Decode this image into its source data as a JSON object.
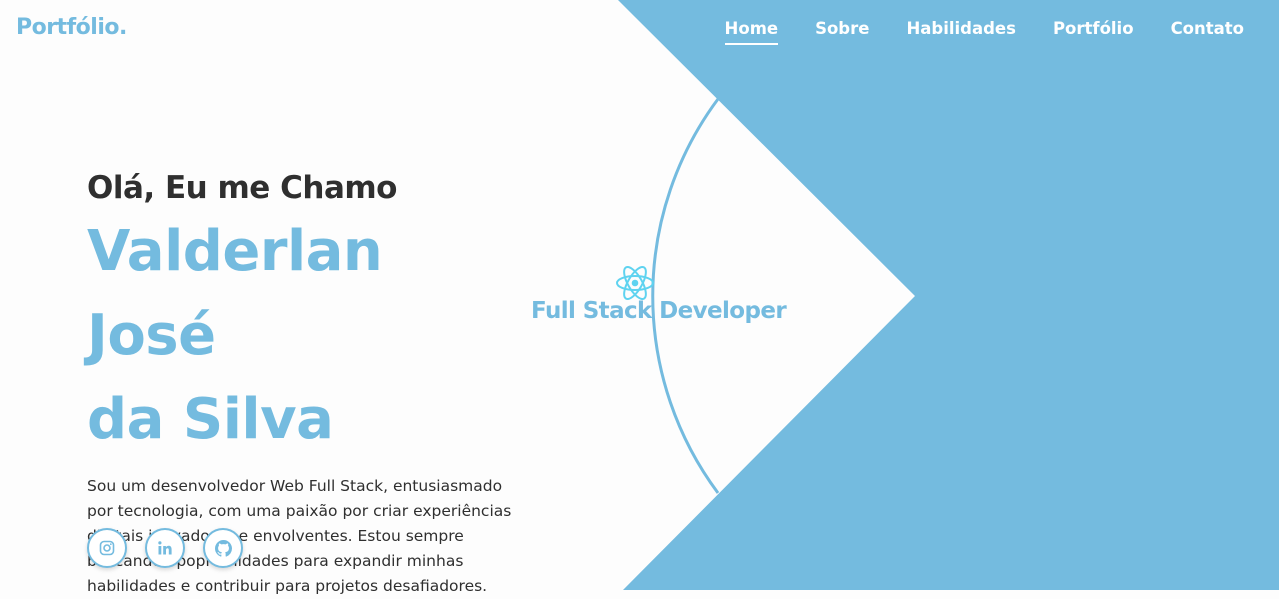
{
  "colors": {
    "accent": "#74bbdf",
    "text": "#2f2f2f",
    "background": "#fdfdfd"
  },
  "header": {
    "logo": "Portfólio.",
    "nav": [
      {
        "label": "Home",
        "active": true
      },
      {
        "label": "Sobre",
        "active": false
      },
      {
        "label": "Habilidades",
        "active": false
      },
      {
        "label": "Portfólio",
        "active": false
      },
      {
        "label": "Contato",
        "active": false
      }
    ]
  },
  "hero": {
    "greeting": "Olá, Eu me Chamo",
    "name_line1": "Valderlan José",
    "name_line2": "da Silva",
    "bio": "Sou um desenvolvedor Web Full Stack, entusiasmado por tecnologia, com uma paixão por criar experiências digitais inovadoras e envolventes. Estou sempre buscando opoprtunidades para expandir minhas habilidades e contribuir para projetos desafiadores."
  },
  "badge": {
    "icon": "react-icon",
    "label": "Full Stack Developer"
  },
  "socials": [
    {
      "icon": "instagram-icon"
    },
    {
      "icon": "linkedin-icon"
    },
    {
      "icon": "github-icon"
    }
  ]
}
